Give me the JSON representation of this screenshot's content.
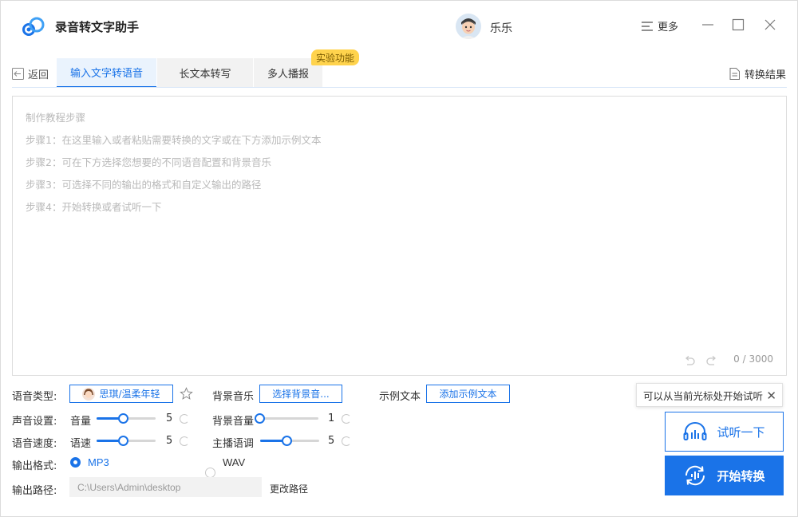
{
  "app": {
    "title": "录音转文字助手",
    "username": "乐乐",
    "more_label": "更多"
  },
  "colors": {
    "accent": "#1a73e8",
    "badge": "#ffd34d"
  },
  "nav": {
    "back_label": "返回",
    "tabs": [
      {
        "label": "输入文字转语音",
        "active": true
      },
      {
        "label": "长文本转写",
        "active": false
      },
      {
        "label": "多人播报",
        "active": false
      }
    ],
    "badge_label": "实验功能",
    "result_label": "转换结果"
  },
  "editor": {
    "placeholder_lines": [
      "制作教程步骤",
      "步骤1：在这里输入或者粘贴需要转换的文字或在下方添加示例文本",
      "步骤2：可在下方选择您想要的不同语音配置和背景音乐",
      "步骤3：可选择不同的输出的格式和自定义输出的路径",
      "步骤4：开始转换或者试听一下"
    ],
    "counter": "0 / 3000"
  },
  "settings": {
    "voice_type": {
      "label": "语音类型:",
      "value": "思琪/温柔年轻"
    },
    "bg_music": {
      "label": "背景音乐",
      "button": "选择背景音..."
    },
    "sample_text": {
      "label": "示例文本",
      "button": "添加示例文本"
    },
    "sound": {
      "label": "声音设置:",
      "volume_label": "音量",
      "volume_value": "5",
      "volume_fraction": 0.45
    },
    "bg_volume": {
      "label": "背景音量",
      "value": "1",
      "fraction": 0.0
    },
    "speed": {
      "label": "语音速度:",
      "speed_label": "语速",
      "speed_value": "5",
      "speed_fraction": 0.45
    },
    "pitch": {
      "label": "主播语调",
      "value": "5",
      "fraction": 0.45
    },
    "format": {
      "label": "输出格式:",
      "options": [
        "MP3",
        "WAV"
      ],
      "selected": "MP3"
    },
    "output_path": {
      "label": "输出路径:",
      "value": "C:\\Users\\Admin\\desktop",
      "change_label": "更改路径"
    }
  },
  "actions": {
    "tooltip": "可以从当前光标处开始试听",
    "listen_label": "试听一下",
    "convert_label": "开始转换"
  }
}
